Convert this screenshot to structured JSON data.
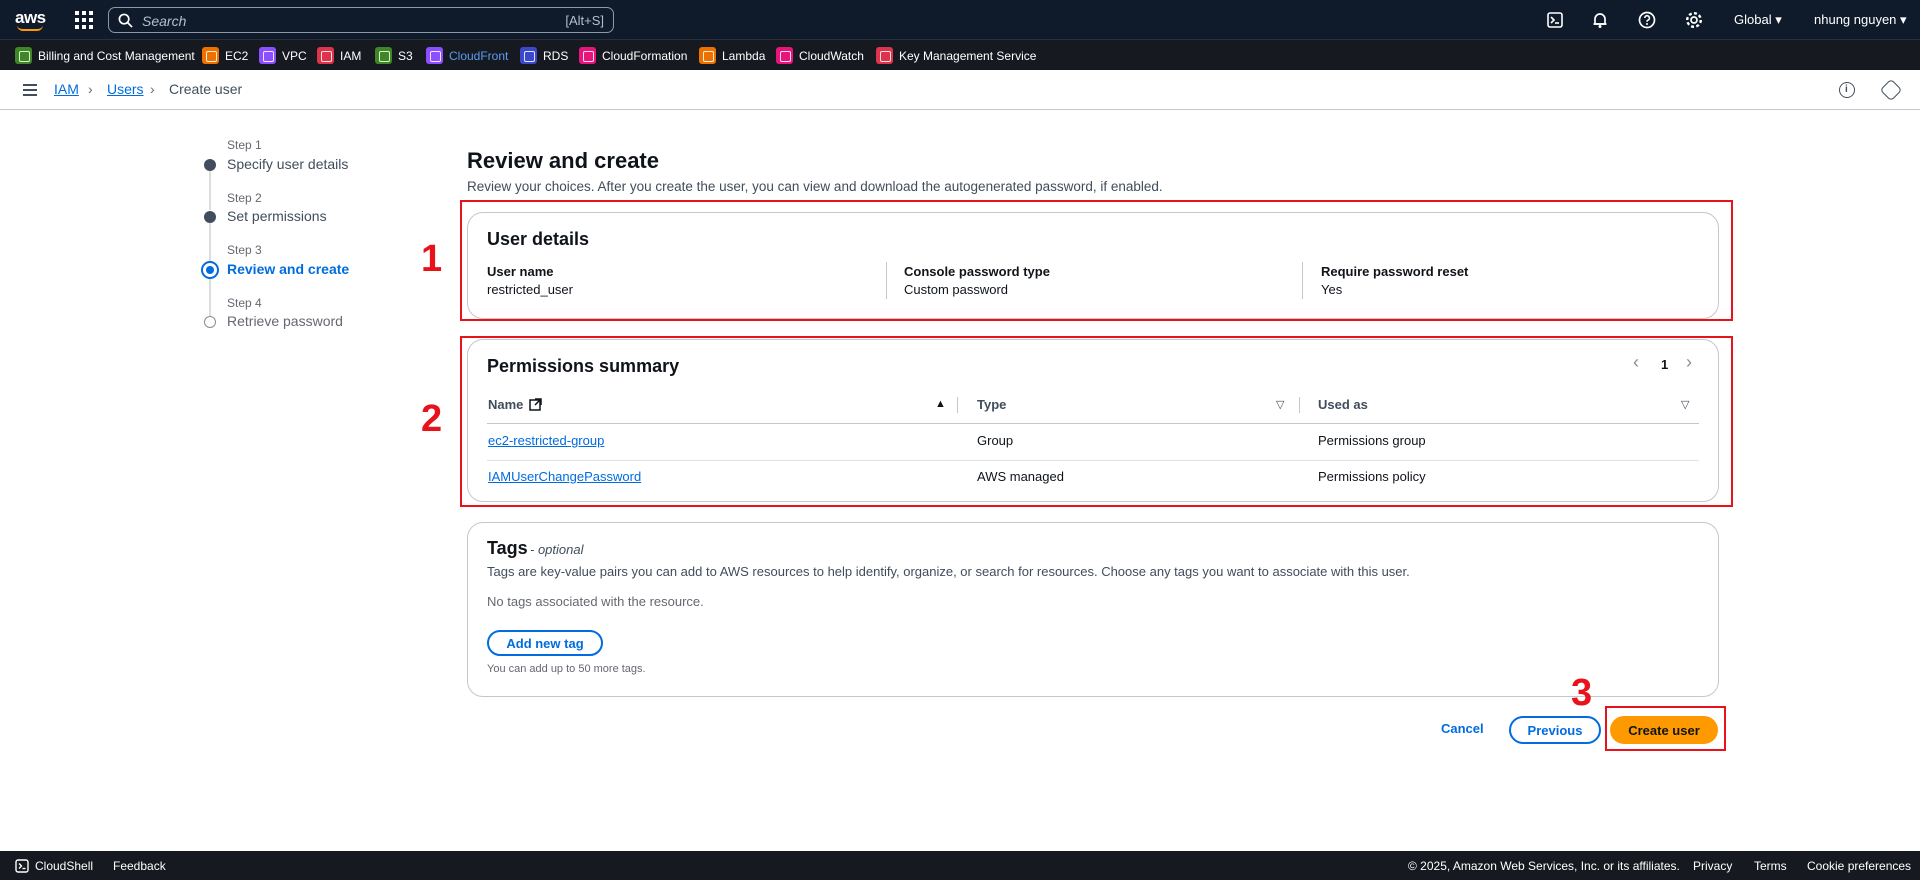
{
  "topnav": {
    "logo": "aws",
    "search_placeholder": "Search",
    "search_shortcut": "[Alt+S]",
    "region": "Global ▾",
    "user": "nhung nguyen ▾",
    "icons": [
      "cloudshell-icon",
      "bell-icon",
      "help-icon",
      "gear-icon"
    ]
  },
  "favorites": [
    {
      "label": "Billing and Cost Management",
      "color": "#3f8624"
    },
    {
      "label": "EC2",
      "color": "#ed7100"
    },
    {
      "label": "VPC",
      "color": "#8c4fff"
    },
    {
      "label": "IAM",
      "color": "#dd344c"
    },
    {
      "label": "S3",
      "color": "#3f8624"
    },
    {
      "label": "CloudFront",
      "color": "#8c4fff"
    },
    {
      "label": "RDS",
      "color": "#3b48cc"
    },
    {
      "label": "CloudFormation",
      "color": "#e7157b"
    },
    {
      "label": "Lambda",
      "color": "#ed7100"
    },
    {
      "label": "CloudWatch",
      "color": "#e7157b"
    },
    {
      "label": "Key Management Service",
      "color": "#dd344c"
    }
  ],
  "breadcrumb": {
    "items": [
      "IAM",
      "Users",
      "Create user"
    ]
  },
  "steps": [
    {
      "num": "Step 1",
      "label": "Specify user details",
      "state": "done"
    },
    {
      "num": "Step 2",
      "label": "Set permissions",
      "state": "done"
    },
    {
      "num": "Step 3",
      "label": "Review and create",
      "state": "current"
    },
    {
      "num": "Step 4",
      "label": "Retrieve password",
      "state": "future"
    }
  ],
  "page": {
    "title": "Review and create",
    "description": "Review your choices. After you create the user, you can view and download the autogenerated password, if enabled."
  },
  "user_details": {
    "title": "User details",
    "fields": [
      {
        "label": "User name",
        "value": "restricted_user"
      },
      {
        "label": "Console password type",
        "value": "Custom password"
      },
      {
        "label": "Require password reset",
        "value": "Yes"
      }
    ]
  },
  "permissions": {
    "title": "Permissions summary",
    "page": "1",
    "columns": [
      "Name",
      "Type",
      "Used as"
    ],
    "rows": [
      {
        "name": "ec2-restricted-group",
        "type": "Group",
        "used_as": "Permissions group"
      },
      {
        "name": "IAMUserChangePassword",
        "type": "AWS managed",
        "used_as": "Permissions policy"
      }
    ]
  },
  "tags": {
    "title": "Tags",
    "optional": "- optional",
    "description": "Tags are key-value pairs you can add to AWS resources to help identify, organize, or search for resources. Choose any tags you want to associate with this user.",
    "empty": "No tags associated with the resource.",
    "add_label": "Add new tag",
    "hint": "You can add up to 50 more tags."
  },
  "actions": {
    "cancel": "Cancel",
    "previous": "Previous",
    "create": "Create user"
  },
  "annotations": [
    "1",
    "2",
    "3"
  ],
  "footer": {
    "cloudshell": "CloudShell",
    "feedback": "Feedback",
    "copyright": "© 2025, Amazon Web Services, Inc. or its affiliates.",
    "privacy": "Privacy",
    "terms": "Terms",
    "cookies": "Cookie preferences"
  }
}
